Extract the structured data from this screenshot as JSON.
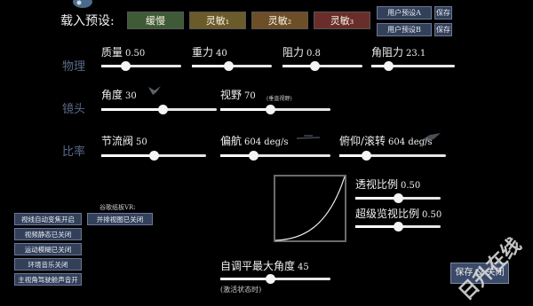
{
  "header": {
    "load_preset_label": "载入预设:",
    "presets": [
      {
        "label": "缓慢",
        "color": "#3f5a36"
      },
      {
        "label": "灵敏₁",
        "color": "#6b5a2a"
      },
      {
        "label": "灵敏₂",
        "color": "#6e4e26"
      },
      {
        "label": "灵敏₃",
        "color": "#6a2e2a"
      }
    ],
    "user_presets": [
      {
        "label": "用户预设A",
        "save": "保存"
      },
      {
        "label": "用户预设B",
        "save": "保存"
      }
    ]
  },
  "sections": {
    "physics": "物理",
    "camera": "镜头",
    "rate": "比率"
  },
  "physics": {
    "mass": {
      "label": "质量",
      "value": "0.50",
      "level": 0.3
    },
    "gravity": {
      "label": "重力",
      "value": "40",
      "level": 0.45
    },
    "drag": {
      "label": "阻力",
      "value": "0.8",
      "level": 0.4
    },
    "angular_drag": {
      "label": "角阻力",
      "value": "23.1",
      "level": 0.2
    }
  },
  "camera": {
    "angle": {
      "label": "角度",
      "value": "30",
      "level": 0.53
    },
    "fov": {
      "label": "视野",
      "value": "70",
      "note": "(垂直视野)",
      "level": 0.45
    }
  },
  "rate": {
    "throttle": {
      "label": "节流阀",
      "value": "50",
      "level": 0.5
    },
    "yaw": {
      "label": "偏航",
      "value": "604 deg/s",
      "level": 0.3
    },
    "pitch_roll": {
      "label": "俯仰/滚转",
      "value": "604 deg/s",
      "level": 0.25
    }
  },
  "view": {
    "view_ratio": {
      "label": "透视比例",
      "value": "0.50",
      "level": 0.5
    },
    "super_view_ratio": {
      "label": "超级览视比例",
      "value": "0.50",
      "level": 0.5
    }
  },
  "left_panel": {
    "vr_label": "谷歌纸板VR:",
    "vr_button": "并排视图已关闭",
    "buttons": [
      "视线自动变焦开启",
      "视频静态已关闭",
      "运动模糊已关闭",
      "环境音乐关闭",
      "主视角驾驶舱声音开"
    ]
  },
  "auto_level": {
    "label": "自调平最大角度",
    "value": "45",
    "note": "(激活状态时)",
    "level": 0.45
  },
  "save_close": "保存 & 关闭",
  "watermark": "日升在线"
}
